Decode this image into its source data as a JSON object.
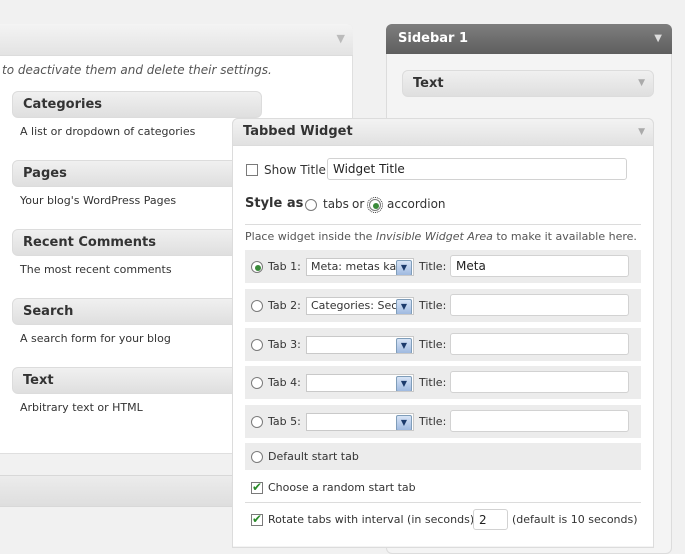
{
  "available": {
    "description": "to deactivate them and delete their settings.",
    "widgets": [
      {
        "title": "Categories",
        "desc": "A list or dropdown of categories"
      },
      {
        "title": "Pages",
        "desc": "Your blog's WordPress Pages"
      },
      {
        "title": "Recent Comments",
        "desc": "The most recent comments"
      },
      {
        "title": "Search",
        "desc": "A search form for your blog"
      },
      {
        "title": "Text",
        "desc": "Arbitrary text or HTML"
      }
    ]
  },
  "sidebar": {
    "title": "Sidebar 1",
    "text_widget": "Text"
  },
  "tabbed": {
    "title": "Tabbed Widget",
    "show_title_label": "Show Title",
    "title_value": "Widget Title",
    "style_label": "Style as",
    "style_colon": ":",
    "tabs_label": "tabs",
    "or_label": "or",
    "accordion_label": "accordion",
    "place_text_1": "Place widget inside the",
    "place_text_em": "Invisible Widget Area",
    "place_text_2": "to make it available here.",
    "title_label": "Title:",
    "tabs": [
      {
        "label": "Tab 1:",
        "select": "Meta: metas kak",
        "title": "Meta"
      },
      {
        "label": "Tab 2:",
        "select": "Categories: Sec",
        "title": ""
      },
      {
        "label": "Tab 3:",
        "select": "",
        "title": ""
      },
      {
        "label": "Tab 4:",
        "select": "",
        "title": ""
      },
      {
        "label": "Tab 5:",
        "select": "",
        "title": ""
      }
    ],
    "default_start": "Default start tab",
    "random_start": "Choose a random start tab",
    "rotate_label": "Rotate tabs with interval (in seconds):",
    "rotate_value": "2",
    "rotate_hint": "(default is 10 seconds)"
  },
  "icons": {
    "arrow": "▼",
    "dropdown": "▼"
  }
}
